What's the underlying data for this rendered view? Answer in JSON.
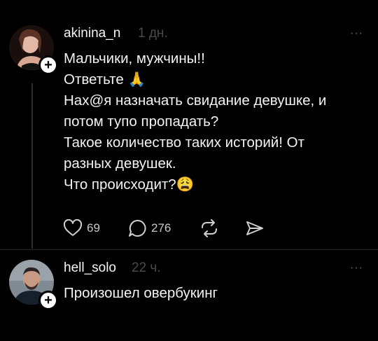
{
  "posts": [
    {
      "username": "akinina_n",
      "time": "1 дн.",
      "more_label": "···",
      "lines": [
        "Мальчики, мужчины!!",
        "Ответьте 🙏",
        "Нах@я назначать свидание девушке, и",
        "потом тупо пропадать?",
        "Такое количество таких историй! От",
        "разных девушек.",
        "Что происходит?😩"
      ],
      "likes": "69",
      "comments": "276",
      "icons": {
        "like": "heart-icon",
        "comment": "comment-bubble-icon",
        "repost": "repost-icon",
        "share": "send-icon",
        "follow": "plus-icon"
      }
    },
    {
      "username": "hell_solo",
      "time": "22 ч.",
      "more_label": "···",
      "lines": [
        "Произошел овербукинг"
      ]
    }
  ]
}
